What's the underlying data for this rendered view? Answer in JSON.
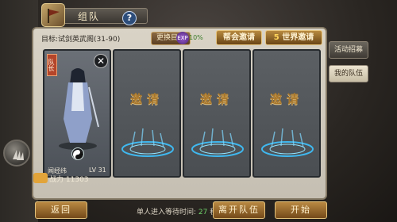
{
  "header": {
    "title": "组队"
  },
  "topbar": {
    "target_label": "目标:",
    "target_value": "试剑英武阁(31-90)",
    "change_target": "更换目标",
    "exp_badge": "EXP",
    "exp_bonus": "10%",
    "guild_invite": "帮会邀请",
    "world_invite_count": "5",
    "world_invite": "世界邀请"
  },
  "side_tabs": [
    {
      "label": "活动招募",
      "active": false
    },
    {
      "label": "我的队伍",
      "active": true
    }
  ],
  "member": {
    "leader_tag": "队长",
    "name": "闻经纬",
    "level": "LV 31",
    "power_label": "战力",
    "power_value": "11303"
  },
  "slots": [
    {
      "label": "邀请"
    },
    {
      "label": "邀请"
    },
    {
      "label": "邀请"
    }
  ],
  "footer": {
    "back": "返回",
    "wait_label": "单人进入等待时间:",
    "wait_value": "27",
    "wait_unit": "秒",
    "leave": "离开队伍",
    "start": "开始"
  },
  "colors": {
    "accent_gold": "#b98942",
    "portal_blue": "#3fb8ef",
    "panel": "#d9d3c6"
  }
}
